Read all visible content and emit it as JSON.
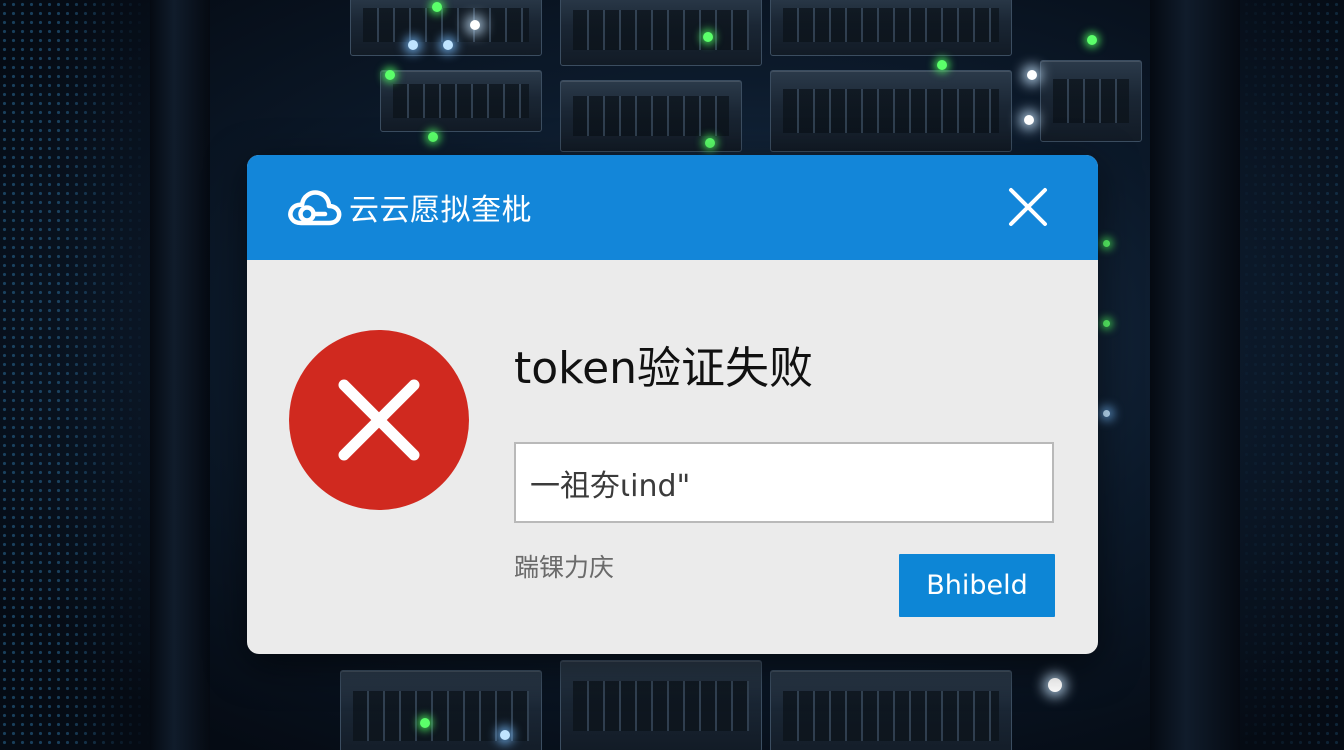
{
  "window": {
    "app_name": "云云愿拟奎枇",
    "icons": {
      "brand": "cloud-icon",
      "close": "close-icon",
      "status": "error-x-icon"
    }
  },
  "dialog": {
    "message_title": "token验证失败",
    "token_input": {
      "value": "一祖夯ɩind\""
    },
    "hint_text": "踹锞力庆",
    "action_button": "Bhibeld"
  },
  "colors": {
    "titlebar": "#1386d9",
    "error_circle": "#d0291f",
    "button": "#0d86d6",
    "dialog_body": "#ebebeb"
  }
}
